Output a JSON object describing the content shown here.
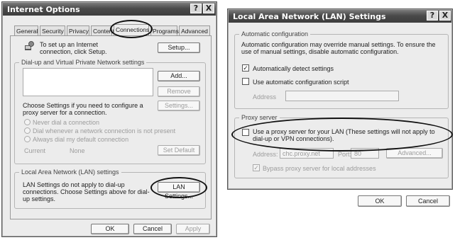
{
  "internet_options": {
    "title": "Internet Options",
    "title_buttons": {
      "help": "?",
      "close": "X"
    },
    "tabs": [
      "General",
      "Security",
      "Privacy",
      "Content",
      "Connections",
      "Programs",
      "Advanced"
    ],
    "setup_text": "To set up an Internet connection, click Setup.",
    "setup_button": "Setup...",
    "dialup_group": "Dial-up and Virtual Private Network settings",
    "add_button": "Add...",
    "remove_button": "Remove",
    "choose_settings_text": "Choose Settings if you need to configure a proxy server for a connection.",
    "settings_button": "Settings...",
    "radio_never": "Never dial a connection",
    "radio_whenever": "Dial whenever a network connection is not present",
    "radio_always": "Always dial my default connection",
    "current_label": "Current",
    "current_value": "None",
    "set_default_button": "Set Default",
    "lan_group": "Local Area Network (LAN) settings",
    "lan_text": "LAN Settings do not apply to dial-up connections. Choose Settings above for dial-up settings.",
    "lan_settings_button": "LAN Settings...",
    "ok_button": "OK",
    "cancel_button": "Cancel",
    "apply_button": "Apply"
  },
  "lan_settings": {
    "title": "Local Area Network (LAN) Settings",
    "title_buttons": {
      "help": "?",
      "close": "X"
    },
    "auto_group": "Automatic configuration",
    "auto_text": "Automatic configuration may override manual settings. To ensure the use of manual settings, disable automatic configuration.",
    "auto_detect_label": "Automatically detect settings",
    "auto_detect_checked": "✓",
    "auto_script_label": "Use automatic configuration script",
    "address_label": "Address",
    "proxy_group": "Proxy server",
    "proxy_label": "Use a proxy server for your LAN (These settings will not apply to dial-up or VPN connections).",
    "proxy_address_label": "Address:",
    "proxy_address_value": "chc.proxy.net",
    "port_label": "Port:",
    "port_value": "80",
    "advanced_button": "Advanced...",
    "bypass_label": "Bypass proxy server for local addresses",
    "bypass_checked": "✓",
    "ok_button": "OK",
    "cancel_button": "Cancel"
  }
}
